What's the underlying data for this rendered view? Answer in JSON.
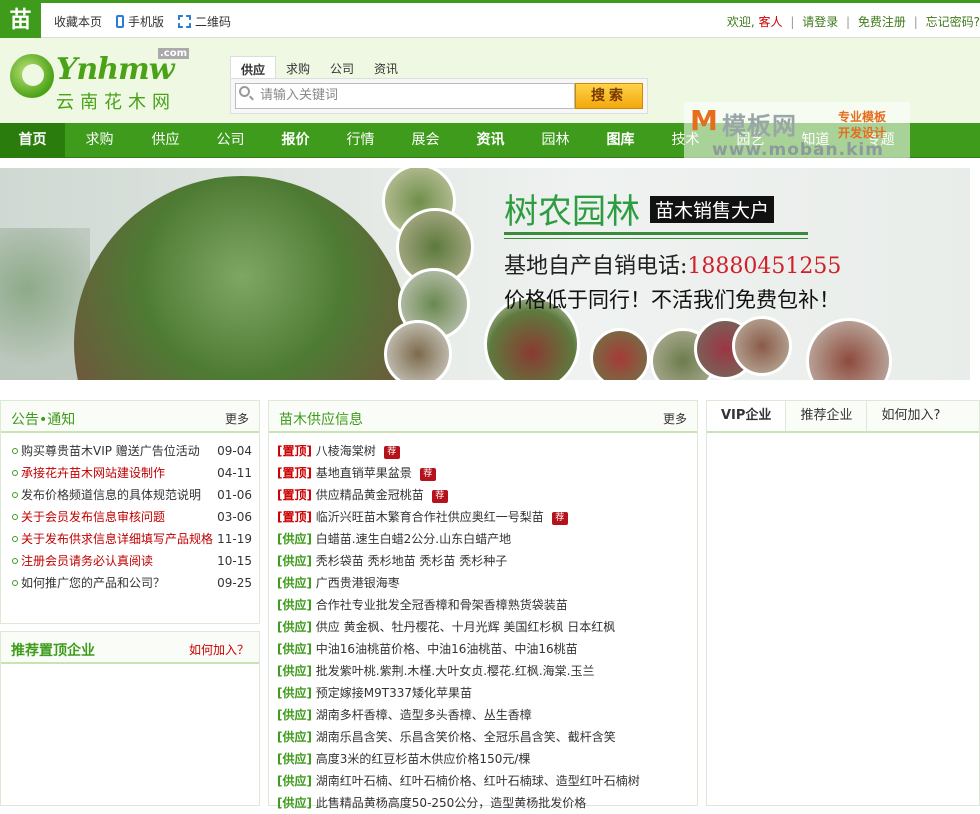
{
  "topbar": {
    "logo_char": "苗",
    "bookmark": "收藏本页",
    "mobile": "手机版",
    "qrcode": "二维码",
    "welcome": "欢迎,",
    "guest": "客人",
    "login": "请登录",
    "register": "免费注册",
    "forgot": "忘记密码?"
  },
  "logo": {
    "en": "Ynhmw",
    "com": ".com",
    "cn": "云南花木网"
  },
  "search": {
    "tabs": [
      "供应",
      "求购",
      "公司",
      "资讯"
    ],
    "placeholder": "请输入关键词",
    "button": "搜索"
  },
  "nav": [
    "首页",
    "求购",
    "供应",
    "公司",
    "报价",
    "行情",
    "展会",
    "资讯",
    "园林",
    "图库",
    "技术",
    "园艺",
    "知道",
    "专题"
  ],
  "watermark": {
    "m": "M",
    "cn": "模板网",
    "r1": "专业模板",
    "r2": "开发设计",
    "url": "www.moban.kim"
  },
  "banner": {
    "title": "树农园林",
    "subtitle": "苗木销售大户",
    "phone_label": "基地自产自销电话:",
    "phone": "18880451255",
    "slogan": "价格低于同行！不活我们免费包补！"
  },
  "notice": {
    "title": "公告•通知",
    "more": "更多",
    "items": [
      {
        "text": "购买尊贵苗木VIP 赠送广告位活动",
        "date": "09-04",
        "color": "#333333"
      },
      {
        "text": "承接花卉苗木网站建设制作",
        "date": "04-11",
        "color": "#c00000"
      },
      {
        "text": "发布价格频道信息的具体规范说明",
        "date": "01-06",
        "color": "#333333"
      },
      {
        "text": "关于会员发布信息审核问题",
        "date": "03-06",
        "color": "#c00000"
      },
      {
        "text": "关于发布供求信息详细填写产品规格",
        "date": "11-19",
        "color": "#c00000"
      },
      {
        "text": "注册会员请务必认真阅读",
        "date": "10-15",
        "color": "#c00000"
      },
      {
        "text": "如何推广您的产品和公司？",
        "date": "09-25",
        "color": "#333333"
      }
    ]
  },
  "recommend": {
    "title": "推荐置顶企业",
    "join": "如何加入？"
  },
  "supply": {
    "title": "苗木供应信息",
    "more": "更多",
    "items": [
      {
        "tag": "[置顶]",
        "text": "八棱海棠树",
        "hot": "荐"
      },
      {
        "tag": "[置顶]",
        "text": "基地直销苹果盆景",
        "hot": "荐"
      },
      {
        "tag": "[置顶]",
        "text": "供应精品黄金冠桃苗",
        "hot": "荐"
      },
      {
        "tag": "[置顶]",
        "text": "临沂兴旺苗木繁育合作社供应奥红一号梨苗",
        "hot": "荐"
      },
      {
        "tag": "[供应]",
        "text": "白蜡苗.速生白蜡2公分.山东白蜡产地"
      },
      {
        "tag": "[供应]",
        "text": "秃杉袋苗 秃杉地苗 秃杉苗 秃杉种子"
      },
      {
        "tag": "[供应]",
        "text": "广西贵港银海枣"
      },
      {
        "tag": "[供应]",
        "text": "合作社专业批发全冠香樟和骨架香樟熟货袋装苗"
      },
      {
        "tag": "[供应]",
        "text": "供应 黄金枫、牡丹樱花、十月光辉 美国红杉枫 日本红枫"
      },
      {
        "tag": "[供应]",
        "text": "中油16油桃苗价格、中油16油桃苗、中油16桃苗"
      },
      {
        "tag": "[供应]",
        "text": "批发紫叶桃.紫荆.木槿.大叶女贞.樱花.红枫.海棠.玉兰"
      },
      {
        "tag": "[供应]",
        "text": "预定嫁接M9T337矮化苹果苗"
      },
      {
        "tag": "[供应]",
        "text": "湖南多杆香樟、造型多头香樟、丛生香樟"
      },
      {
        "tag": "[供应]",
        "text": "湖南乐昌含笑、乐昌含笑价格、全冠乐昌含笑、截杆含笑"
      },
      {
        "tag": "[供应]",
        "text": "高度3米的红豆杉苗木供应价格150元/棵"
      },
      {
        "tag": "[供应]",
        "text": "湖南红叶石楠、红叶石楠价格、红叶石楠球、造型红叶石楠树"
      },
      {
        "tag": "[供应]",
        "text": "此售精品黄杨高度50-250公分，造型黄杨批发价格"
      }
    ]
  },
  "vip": {
    "tabs": [
      "VIP企业",
      "推荐企业",
      "如何加入?"
    ]
  },
  "colors": {
    "brand_green": "#3e9b1c",
    "nav_active": "#2a7d0c",
    "red": "#c00000"
  }
}
